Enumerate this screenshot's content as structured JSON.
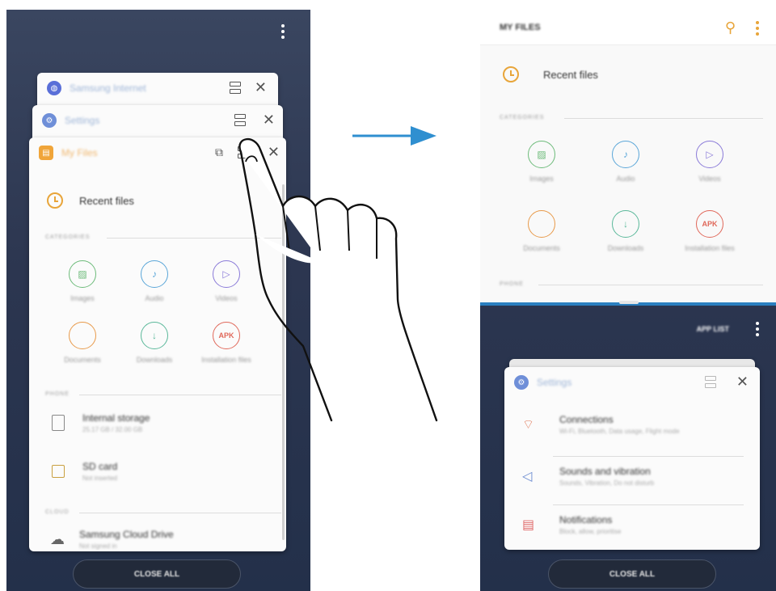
{
  "left_panel": {
    "cards": [
      {
        "title": "Samsung Internet",
        "icon_color": "#5a6fd8",
        "icon": "globe-icon"
      },
      {
        "title": "Settings",
        "icon_color": "#6f8fd8",
        "icon": "gear-icon"
      },
      {
        "title": "My Files",
        "icon_color": "#f0a53a",
        "icon": "folder-icon"
      }
    ],
    "recent_label": "Recent files",
    "categories_label": "CATEGORIES",
    "categories": [
      {
        "label": "Images",
        "color": "#6dbb7a",
        "icon": "image-icon",
        "glyph": "▨"
      },
      {
        "label": "Audio",
        "color": "#5aa6d8",
        "icon": "music-icon",
        "glyph": "♪"
      },
      {
        "label": "Videos",
        "color": "#8a7ad8",
        "icon": "video-icon",
        "glyph": "▷"
      },
      {
        "label": "Documents",
        "color": "#e89a4a",
        "icon": "document-icon",
        "glyph": ""
      },
      {
        "label": "Downloads",
        "color": "#5ab89a",
        "icon": "download-icon",
        "glyph": "↓"
      },
      {
        "label": "Installation files",
        "color": "#e0685a",
        "icon": "apk-icon",
        "glyph": "APK"
      }
    ],
    "phone_label": "PHONE",
    "storage": [
      {
        "title": "Internal storage",
        "sub": "25.17 GB / 32.00 GB"
      },
      {
        "title": "SD card",
        "sub": "Not inserted"
      }
    ],
    "cloud_label": "CLOUD",
    "cloud": [
      {
        "title": "Samsung Cloud Drive",
        "sub": "Not signed in"
      }
    ],
    "close_all": "CLOSE ALL"
  },
  "right_panel": {
    "header_title": "MY FILES",
    "recent_label": "Recent files",
    "categories_label": "CATEGORIES",
    "categories": [
      {
        "label": "Images",
        "color": "#6dbb7a",
        "icon": "image-icon",
        "glyph": "▨"
      },
      {
        "label": "Audio",
        "color": "#5aa6d8",
        "icon": "music-icon",
        "glyph": "♪"
      },
      {
        "label": "Videos",
        "color": "#8a7ad8",
        "icon": "video-icon",
        "glyph": "▷"
      },
      {
        "label": "Documents",
        "color": "#e89a4a",
        "icon": "document-icon",
        "glyph": ""
      },
      {
        "label": "Downloads",
        "color": "#5ab89a",
        "icon": "download-icon",
        "glyph": "↓"
      },
      {
        "label": "Installation files",
        "color": "#e0685a",
        "icon": "apk-icon",
        "glyph": "APK"
      }
    ],
    "phone_label": "PHONE",
    "app_list": "APP LIST",
    "settings_card": {
      "title": "Settings",
      "items": [
        {
          "title": "Connections",
          "sub": "Wi-Fi, Bluetooth, Data usage, Flight mode",
          "icon": "connections-icon"
        },
        {
          "title": "Sounds and vibration",
          "sub": "Sounds, Vibration, Do not disturb",
          "icon": "sound-icon"
        },
        {
          "title": "Notifications",
          "sub": "Block, allow, prioritise",
          "icon": "notifications-icon"
        }
      ]
    },
    "close_all": "CLOSE ALL"
  },
  "colors": {
    "accent_blue": "#2f8fd0",
    "orange": "#e8a53a"
  }
}
